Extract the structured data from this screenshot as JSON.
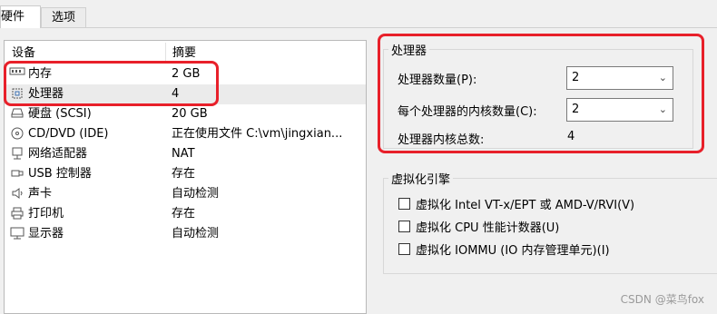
{
  "tabs": [
    {
      "label": "硬件"
    },
    {
      "label": "选项"
    }
  ],
  "device_list": {
    "col_device": "设备",
    "col_summary": "摘要",
    "rows": [
      {
        "icon": "memory-icon",
        "name": "内存",
        "summary": "2 GB"
      },
      {
        "icon": "processor-icon",
        "name": "处理器",
        "summary": "4"
      },
      {
        "icon": "hard-disk-icon",
        "name": "硬盘 (SCSI)",
        "summary": "20 GB"
      },
      {
        "icon": "cd-dvd-icon",
        "name": "CD/DVD (IDE)",
        "summary": "正在使用文件 C:\\vm\\jingxian..."
      },
      {
        "icon": "network-adapter-icon",
        "name": "网络适配器",
        "summary": "NAT"
      },
      {
        "icon": "usb-icon",
        "name": "USB 控制器",
        "summary": "存在"
      },
      {
        "icon": "sound-card-icon",
        "name": "声卡",
        "summary": "自动检测"
      },
      {
        "icon": "printer-icon",
        "name": "打印机",
        "summary": "存在"
      },
      {
        "icon": "display-icon",
        "name": "显示器",
        "summary": "自动检测"
      }
    ]
  },
  "processor": {
    "title": "处理器",
    "count_label": "处理器数量(P):",
    "count_value": "2",
    "cores_label": "每个处理器的内核数量(C):",
    "cores_value": "2",
    "total_label": "处理器内核总数:",
    "total_value": "4"
  },
  "virtualization": {
    "title": "虚拟化引擎",
    "options": [
      {
        "label": "虚拟化 Intel VT-x/EPT 或 AMD-V/RVI(V)",
        "checked": false
      },
      {
        "label": "虚拟化 CPU 性能计数器(U)",
        "checked": false
      },
      {
        "label": "虚拟化 IOMMU (IO 内存管理单元)(I)",
        "checked": false
      }
    ]
  },
  "watermark": "CSDN @菜鸟fox",
  "colors": {
    "highlight": "#e8202a",
    "selected_row": "#ebebeb"
  }
}
